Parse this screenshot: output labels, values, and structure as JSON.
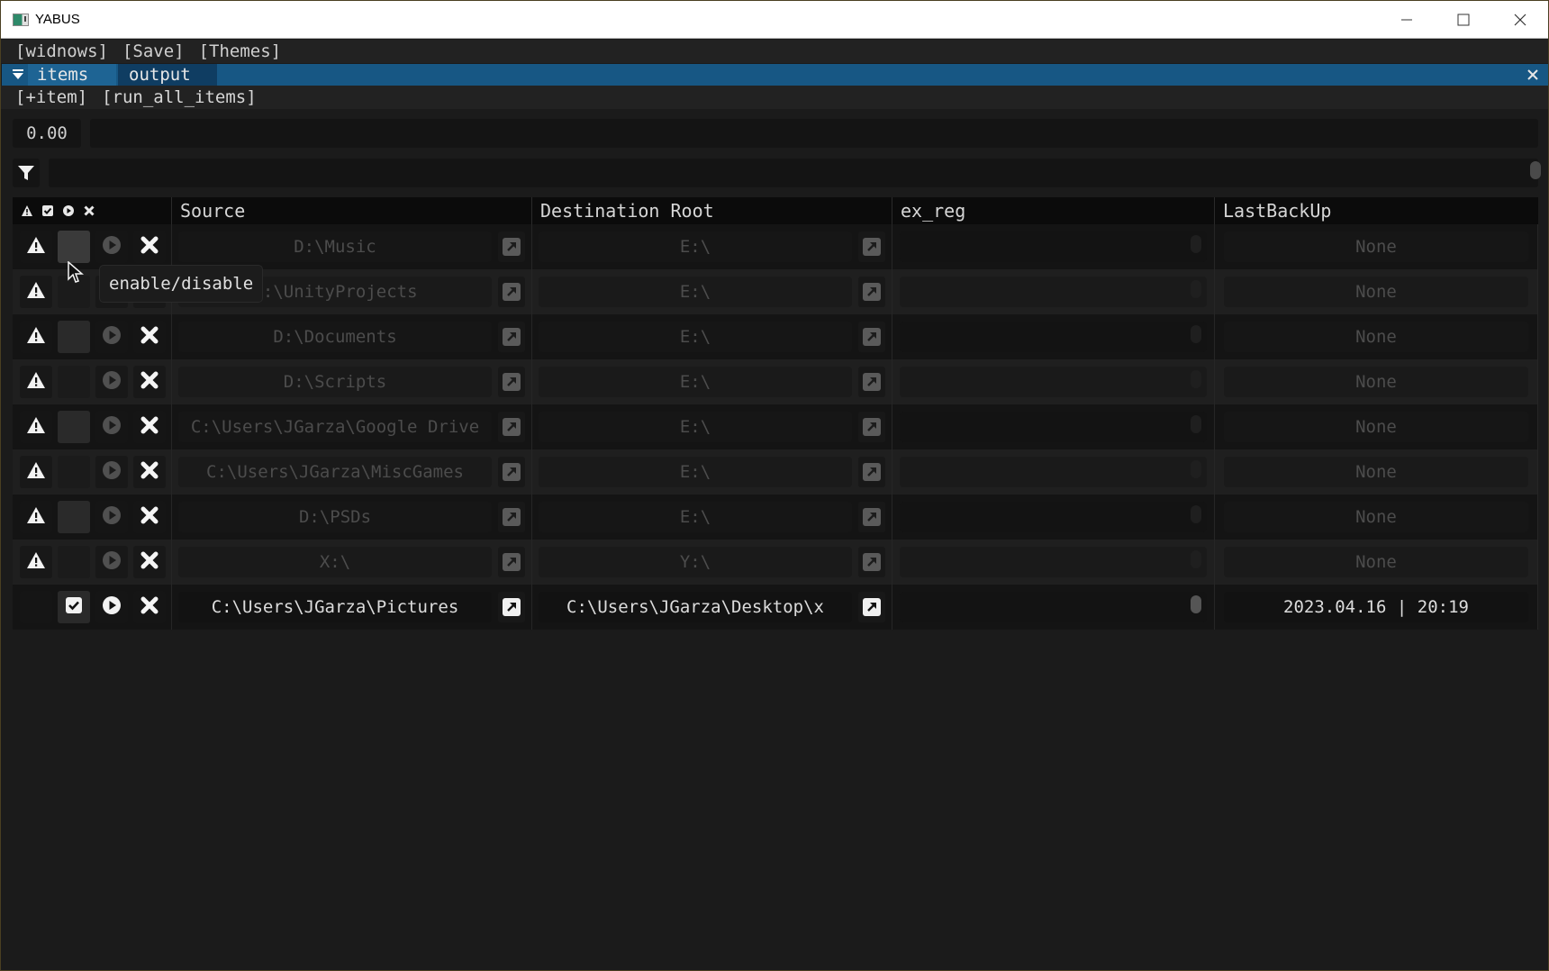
{
  "window": {
    "title": "YABUS",
    "controls": [
      "minimize",
      "maximize",
      "close"
    ]
  },
  "menubar": {
    "items": [
      "[widnows]",
      "[Save]",
      "[Themes]"
    ]
  },
  "tabs": {
    "items": [
      {
        "label": "items",
        "active": true
      },
      {
        "label": "output",
        "active": false
      }
    ]
  },
  "toolbar": {
    "add_item": "[+item]",
    "run_all": "[run_all_items]"
  },
  "progress": {
    "value_label": "0.00",
    "fraction": 0.0
  },
  "filter": {
    "value": "",
    "placeholder": ""
  },
  "table": {
    "header_icons": [
      "warning-icon",
      "checkbox-icon",
      "play-icon",
      "delete-icon"
    ],
    "columns": [
      "Source",
      "Destination Root",
      "ex_reg",
      "LastBackUp"
    ],
    "rows": [
      {
        "warning": true,
        "enabled": false,
        "source": "D:\\Music",
        "destination": "E:\\",
        "ex_reg": "",
        "last_backup": "None"
      },
      {
        "warning": true,
        "enabled": false,
        "source": "D:\\UnityProjects",
        "destination": "E:\\",
        "ex_reg": "",
        "last_backup": "None"
      },
      {
        "warning": true,
        "enabled": false,
        "source": "D:\\Documents",
        "destination": "E:\\",
        "ex_reg": "",
        "last_backup": "None"
      },
      {
        "warning": true,
        "enabled": false,
        "source": "D:\\Scripts",
        "destination": "E:\\",
        "ex_reg": "",
        "last_backup": "None"
      },
      {
        "warning": true,
        "enabled": false,
        "source": "C:\\Users\\JGarza\\Google Drive",
        "destination": "E:\\",
        "ex_reg": "",
        "last_backup": "None"
      },
      {
        "warning": true,
        "enabled": false,
        "source": "C:\\Users\\JGarza\\MiscGames",
        "destination": "E:\\",
        "ex_reg": "",
        "last_backup": "None"
      },
      {
        "warning": true,
        "enabled": false,
        "source": "D:\\PSDs",
        "destination": "E:\\",
        "ex_reg": "",
        "last_backup": "None"
      },
      {
        "warning": true,
        "enabled": false,
        "source": "X:\\",
        "destination": "Y:\\",
        "ex_reg": "",
        "last_backup": "None"
      },
      {
        "warning": false,
        "enabled": true,
        "source": "C:\\Users\\JGarza\\Pictures",
        "destination": "C:\\Users\\JGarza\\Desktop\\x",
        "ex_reg": "",
        "last_backup": "2023.04.16 | 20:19"
      }
    ]
  },
  "tooltip": {
    "text": "enable/disable"
  },
  "colors": {
    "tab_bar": "#175784",
    "tab_active": "#1e6494",
    "tab_inactive": "#0f3d62",
    "background": "#1b1b1b"
  }
}
